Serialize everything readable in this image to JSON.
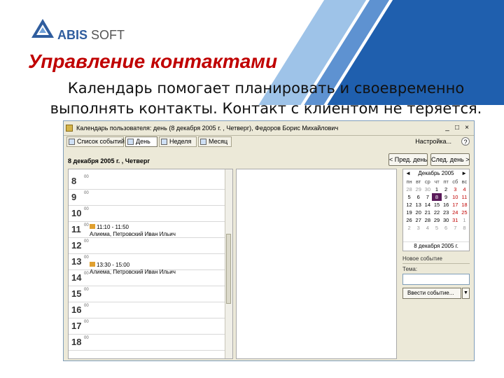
{
  "colors": {
    "band_dark": "#1f5fae",
    "band_light": "#9ec3e8",
    "title": "#c00000",
    "brand_blue": "#2f5d9e"
  },
  "logo": {
    "brand": "ABIS",
    "suffix": " SOFT"
  },
  "slide": {
    "title": "Управление контактами",
    "subtitle": "Календарь помогает планировать и своевременно выполнять контакты. Контакт с клиентом не теряется."
  },
  "window": {
    "title": "Календарь пользователя: день (8 декабря 2005 г. , Четверг), Федоров Борис Михайлович",
    "minimize": "_",
    "maximize": "□",
    "close": "×",
    "tabs": [
      {
        "label": "Список событий",
        "icon": "list-icon"
      },
      {
        "label": "День",
        "icon": "day-icon"
      },
      {
        "label": "Неделя",
        "icon": "week-icon"
      },
      {
        "label": "Месяц",
        "icon": "month-icon"
      }
    ],
    "settings_label": "Настройка...",
    "help": "?",
    "date_heading": "8 декабря 2005 г. , Четверг",
    "prev_day": "< Пред. день",
    "next_day": "След. день >",
    "hours": [
      {
        "hour": "8",
        "min": "00"
      },
      {
        "hour": "9",
        "min": "00"
      },
      {
        "hour": "10",
        "min": "00"
      },
      {
        "hour": "11",
        "min": "00"
      },
      {
        "hour": "12",
        "min": "00"
      },
      {
        "hour": "13",
        "min": "00"
      },
      {
        "hour": "14",
        "min": "00"
      },
      {
        "hour": "15",
        "min": "00"
      },
      {
        "hour": "16",
        "min": "00"
      },
      {
        "hour": "17",
        "min": "00"
      },
      {
        "hour": "18",
        "min": "00"
      }
    ],
    "events": [
      {
        "time": "11:10 - 11:50",
        "who": "Алиема, Петровский Иван Ильич"
      },
      {
        "time": "13:30 - 15:00",
        "who": "Алиема, Петровский Иван Ильич"
      }
    ],
    "calendar": {
      "month_label": "Декабрь 2005",
      "prev": "◄",
      "next": "►",
      "weekdays": [
        "пн",
        "вт",
        "ср",
        "чт",
        "пт",
        "сб",
        "вс"
      ],
      "weeks": [
        [
          "28",
          "29",
          "30",
          "1",
          "2",
          "3",
          "4"
        ],
        [
          "5",
          "6",
          "7",
          "8",
          "9",
          "10",
          "11"
        ],
        [
          "12",
          "13",
          "14",
          "15",
          "16",
          "17",
          "18"
        ],
        [
          "19",
          "20",
          "21",
          "22",
          "23",
          "24",
          "25"
        ],
        [
          "26",
          "27",
          "28",
          "29",
          "30",
          "31",
          "1"
        ],
        [
          "2",
          "3",
          "4",
          "5",
          "6",
          "7",
          "8"
        ]
      ],
      "selected_day": "8",
      "footer": "8 декабря 2005 г."
    },
    "new_event_label": "Новое событие",
    "subject_label": "Тема:",
    "subject_value": "",
    "add_event_button": "Ввести событие...",
    "add_event_dropdown": "▼"
  }
}
